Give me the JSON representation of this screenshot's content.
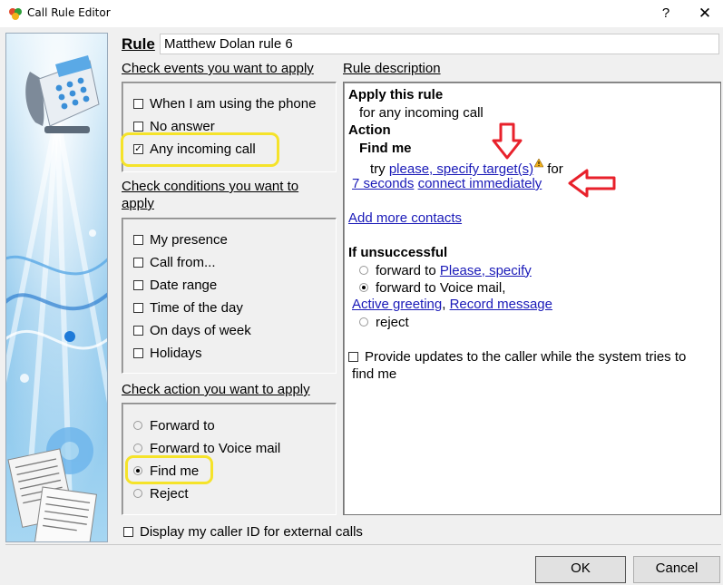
{
  "window": {
    "title": "Call Rule Editor",
    "help_label": "?",
    "close_label": "✕"
  },
  "rule": {
    "label": "Rule",
    "name": "Matthew Dolan rule 6"
  },
  "events": {
    "title": "Check events you want to apply",
    "items": [
      {
        "label": "When I am using the phone",
        "checked": false
      },
      {
        "label": "No answer",
        "checked": false
      },
      {
        "label": "Any incoming call",
        "checked": true
      }
    ]
  },
  "conditions": {
    "title": "Check conditions you want to apply",
    "title_line1": "Check conditions you want to",
    "title_line2": "apply",
    "items": [
      {
        "label": "My presence",
        "checked": false
      },
      {
        "label": "Call from...",
        "checked": false
      },
      {
        "label": "Date range",
        "checked": false
      },
      {
        "label": "Time of the day",
        "checked": false
      },
      {
        "label": "On days of week",
        "checked": false
      },
      {
        "label": "Holidays",
        "checked": false
      }
    ]
  },
  "actions": {
    "title": "Check action you want to apply",
    "items": [
      {
        "label": "Forward to",
        "selected": false
      },
      {
        "label": "Forward to Voice mail",
        "selected": false
      },
      {
        "label": "Find me",
        "selected": true
      },
      {
        "label": "Reject",
        "selected": false
      }
    ]
  },
  "caller_id": {
    "label": "Display my caller ID for external calls",
    "checked": false
  },
  "description": {
    "title": "Rule description",
    "apply_heading": "Apply this rule",
    "apply_text": "for any incoming call",
    "action_heading": "Action",
    "find_me_heading": "Find me",
    "try_text": "try",
    "target_link": "please, specify target(s)",
    "for_text": "for",
    "seconds_link": "7 seconds",
    "connect_link": "connect immediately",
    "add_contacts_link": "Add more contacts",
    "unsuccessful_heading": "If unsuccessful",
    "forward_to_text": "forward to",
    "specify_link": "Please, specify",
    "voicemail_text": "forward to Voice mail,",
    "active_greeting_link": "Active greeting",
    "comma": ",",
    "record_link": "Record message",
    "reject_text": "reject",
    "updates_label": "Provide updates to the caller while the system tries to",
    "updates_label2": "find me",
    "unsuccessful_options": [
      {
        "label": "forward to",
        "selected": false
      },
      {
        "label": "forward to Voice mail,",
        "selected": true
      },
      {
        "label": "reject",
        "selected": false
      }
    ]
  },
  "buttons": {
    "ok": "OK",
    "cancel": "Cancel"
  },
  "icons": {
    "app": "app-logo-icon",
    "warning": "warning-icon",
    "phone_illustration": "telephone-illustration"
  },
  "colors": {
    "highlight": "#f5e32a",
    "arrow": "#e8212b",
    "link": "#1a1ab8"
  }
}
